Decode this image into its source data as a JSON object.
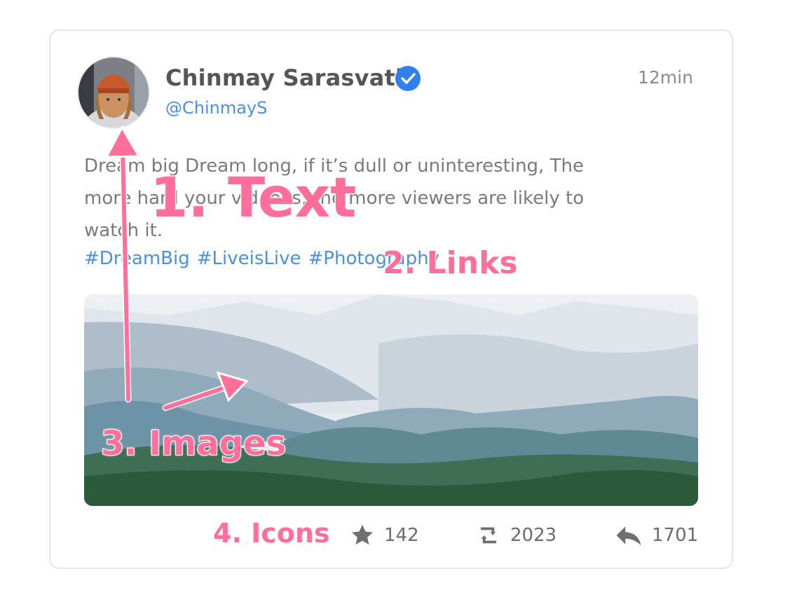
{
  "post": {
    "author_name": "Chinmay Sarasvati",
    "handle": "@ChinmayS",
    "timestamp": "12min",
    "text": "Dream big Dream long, if it’s dull or uninteresting, The more hard your video is, the more viewers are likely to watch it.",
    "hashtags": [
      "#DreamBig",
      "#LiveisLive",
      "#Photography"
    ],
    "verified_icon": "verified-badge-icon",
    "image_subject": "mountain-landscape",
    "accent_color": "#4a90e2"
  },
  "stats": {
    "likes": "142",
    "retweets": "2023",
    "replies": "1701",
    "icons": [
      "star-icon",
      "retweet-icon",
      "reply-icon"
    ]
  },
  "annotations": {
    "label_1": "1. Text",
    "label_2": "2. Links",
    "label_3": "3. Images",
    "label_4": "4. Icons",
    "color": "#ff6f9a"
  }
}
